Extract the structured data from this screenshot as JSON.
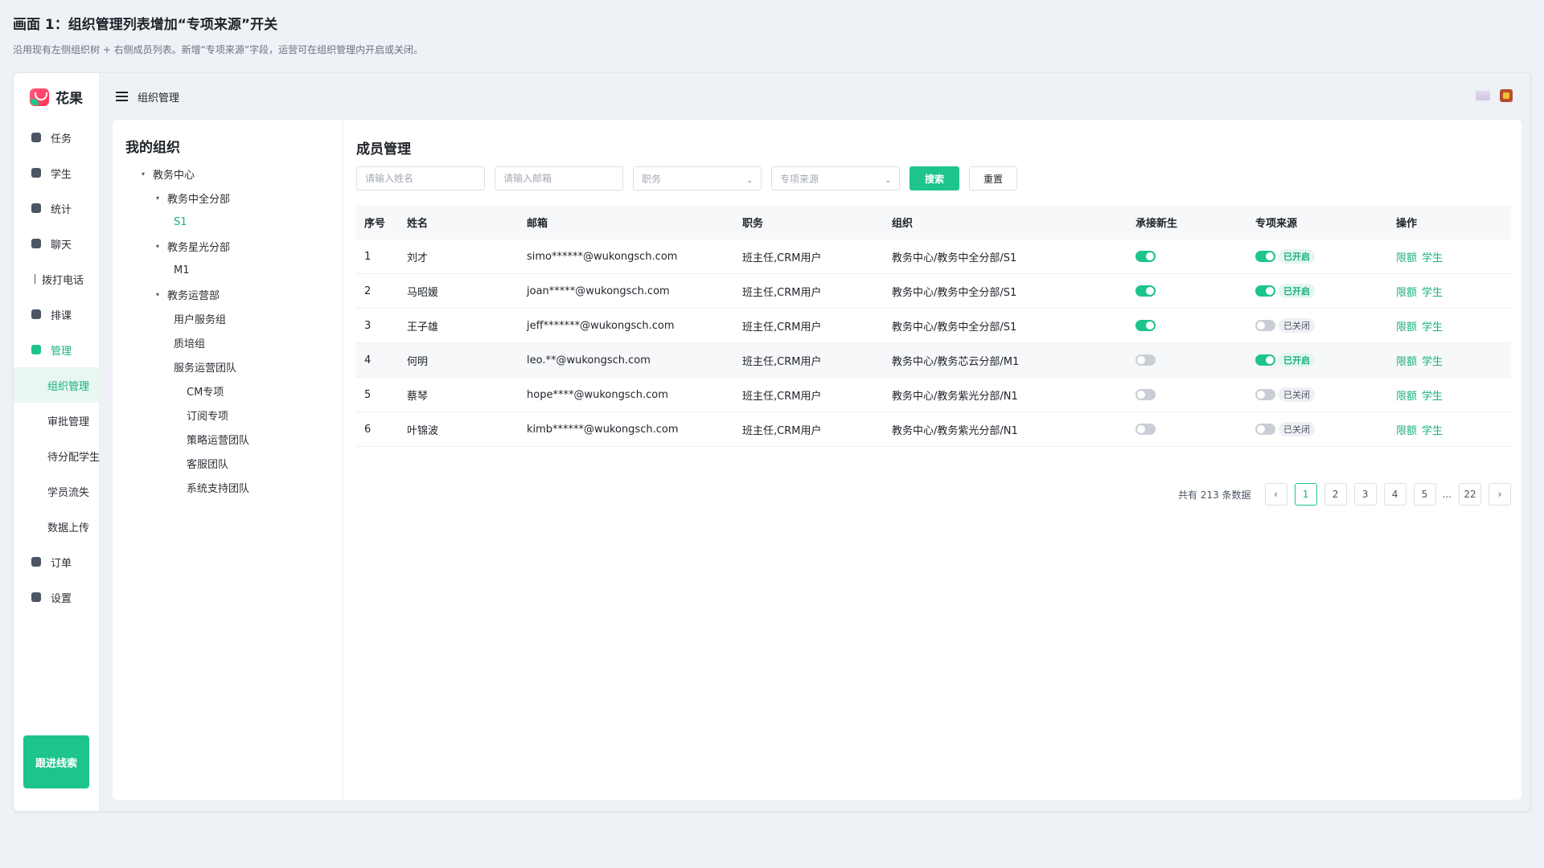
{
  "page": {
    "title": "画面 1：组织管理列表增加“专项来源”开关",
    "subtitle": "沿用现有左侧组织树 + 右侧成员列表。新增“专项来源”字段，运营可在组织管理内开启或关闭。"
  },
  "app": {
    "name": "花果"
  },
  "nav": {
    "items": [
      {
        "label": "任务"
      },
      {
        "label": "学生"
      },
      {
        "label": "统计"
      },
      {
        "label": "聊天"
      },
      {
        "label": "拨打电话"
      },
      {
        "label": "排课"
      },
      {
        "label": "管理"
      }
    ],
    "sub_items": [
      {
        "label": "组织管理"
      },
      {
        "label": "审批管理"
      },
      {
        "label": "待分配学生"
      },
      {
        "label": "学员流失"
      },
      {
        "label": "数据上传"
      }
    ],
    "bottom_items": [
      {
        "label": "订单"
      },
      {
        "label": "设置"
      }
    ],
    "follow_button": "跟进线索"
  },
  "topbar": {
    "breadcrumb": "组织管理"
  },
  "tree": {
    "title": "我的组织",
    "nodes": [
      {
        "label": "教务中心"
      },
      {
        "label": "教务中全分部"
      },
      {
        "label": "S1"
      },
      {
        "label": "教务星光分部"
      },
      {
        "label": "M1"
      },
      {
        "label": "教务运营部"
      },
      {
        "label": "用户服务组"
      },
      {
        "label": "质培组"
      },
      {
        "label": "服务运营团队"
      },
      {
        "label": "CM专项"
      },
      {
        "label": "订阅专项"
      },
      {
        "label": "策略运营团队"
      },
      {
        "label": "客服团队"
      },
      {
        "label": "系统支持团队"
      }
    ]
  },
  "members": {
    "title": "成员管理",
    "filters": {
      "name_placeholder": "请输入姓名",
      "email_placeholder": "请输入邮箱",
      "role_placeholder": "职务",
      "source_placeholder": "专项来源",
      "search_label": "搜索",
      "reset_label": "重置"
    },
    "columns": [
      "序号",
      "姓名",
      "邮箱",
      "职务",
      "组织",
      "承接新生",
      "专项来源",
      "操作"
    ],
    "rows": [
      {
        "no": "1",
        "name": "刘才",
        "email": "simo******@wukongsch.com",
        "role": "班主任,CRM用户",
        "org": "教务中心/教务中全分部/S1",
        "accept_new": true,
        "special_source": true,
        "source_tag": "已开启"
      },
      {
        "no": "2",
        "name": "马昭媛",
        "email": "joan*****@wukongsch.com",
        "role": "班主任,CRM用户",
        "org": "教务中心/教务中全分部/S1",
        "accept_new": true,
        "special_source": true,
        "source_tag": "已开启"
      },
      {
        "no": "3",
        "name": "王子雄",
        "email": "jeff*******@wukongsch.com",
        "role": "班主任,CRM用户",
        "org": "教务中心/教务中全分部/S1",
        "accept_new": true,
        "special_source": false,
        "source_tag": "已关闭"
      },
      {
        "no": "4",
        "name": "何明",
        "email": "leo.**@wukongsch.com",
        "role": "班主任,CRM用户",
        "org": "教务中心/教务芯云分部/M1",
        "accept_new": false,
        "special_source": true,
        "source_tag": "已开启"
      },
      {
        "no": "5",
        "name": "蔡琴",
        "email": "hope****@wukongsch.com",
        "role": "班主任,CRM用户",
        "org": "教务中心/教务紫光分部/N1",
        "accept_new": false,
        "special_source": false,
        "source_tag": "已关闭"
      },
      {
        "no": "6",
        "name": "叶锦波",
        "email": "kimb******@wukongsch.com",
        "role": "班主任,CRM用户",
        "org": "教务中心/教务紫光分部/N1",
        "accept_new": false,
        "special_source": false,
        "source_tag": "已关闭"
      }
    ],
    "actions": {
      "quota": "限额",
      "students": "学生"
    },
    "pagination": {
      "total_text": "共有 213 条数据",
      "prev": "‹",
      "next": "›",
      "pages": [
        "1",
        "2",
        "3",
        "4",
        "5"
      ],
      "ellipsis": "...",
      "last": "22",
      "current": "1"
    }
  },
  "colors": {
    "accent": "#1dc48c",
    "accent_text": "#17b27d"
  }
}
